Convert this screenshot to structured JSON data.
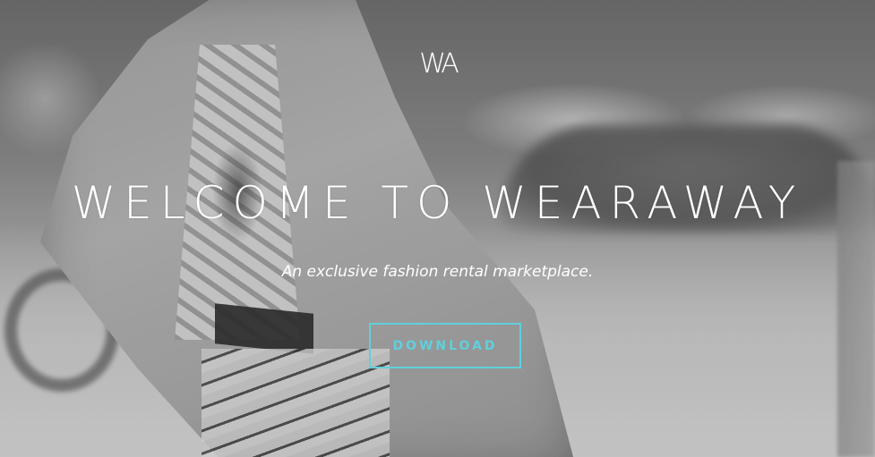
{
  "hero": {
    "logo_text": "WA",
    "title": "WELCOME TO WEARAWAY",
    "subtitle": "An exclusive fashion rental marketplace.",
    "download_label": "DOWNLOAD"
  },
  "colors": {
    "accent": "#5fd0dc",
    "text": "#ffffff"
  }
}
